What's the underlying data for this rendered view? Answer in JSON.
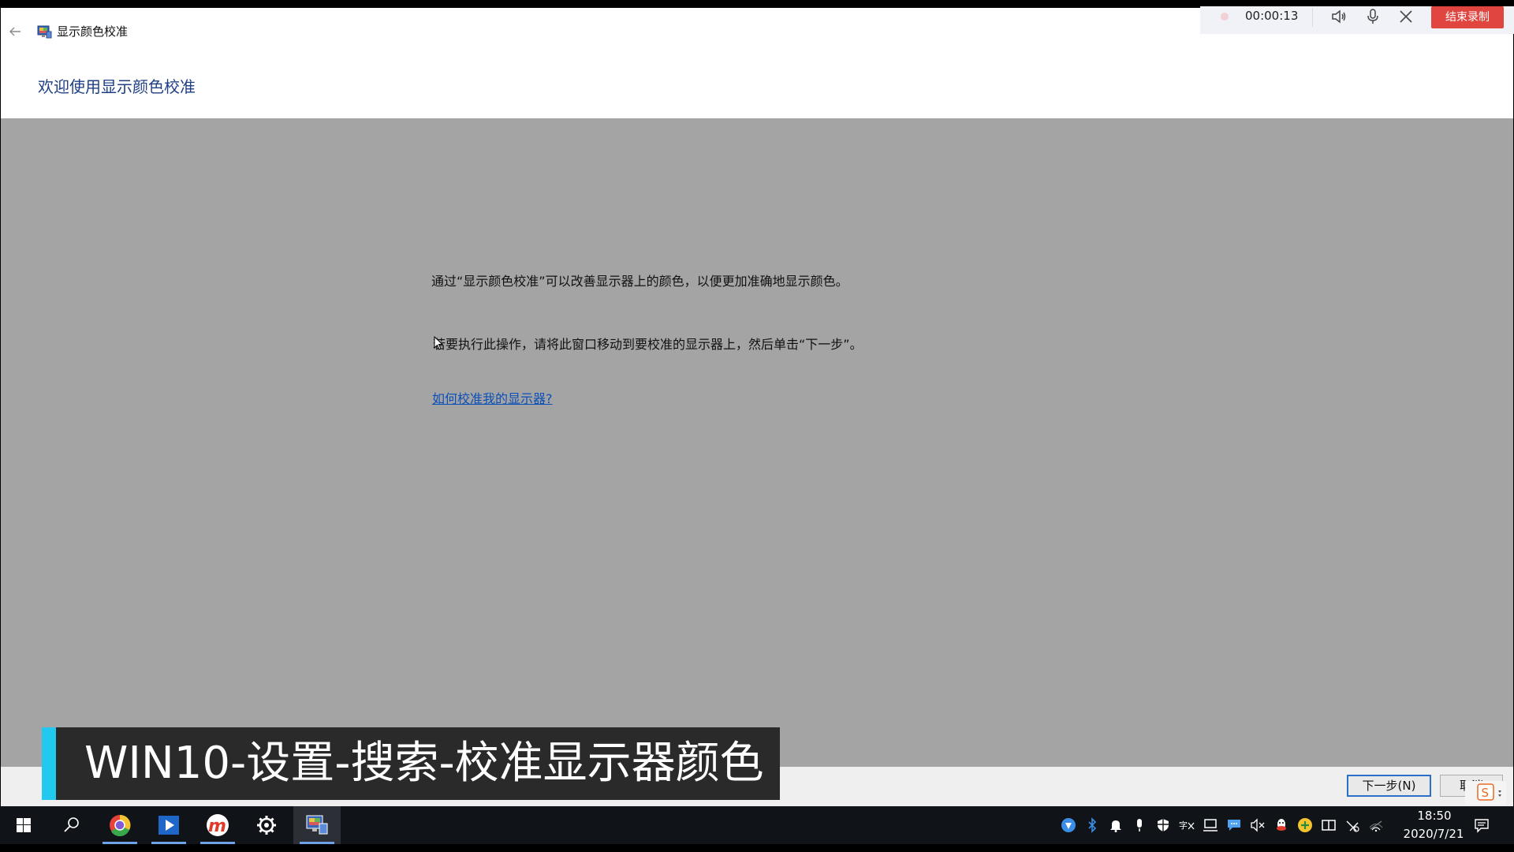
{
  "window": {
    "title": "显示颜色校准",
    "heading": "欢迎使用显示颜色校准"
  },
  "content": {
    "paragraph1": "通过“显示颜色校准”可以改善显示器上的颜色，以便更加准确地显示颜色。",
    "paragraph2": "若要执行此操作，请将此窗口移动到要校准的显示器上，然后单击“下一步”。",
    "help_link": "如何校准我的显示器?"
  },
  "buttons": {
    "next": "下一步(N)",
    "cancel": "取消"
  },
  "recorder": {
    "time": "00:00:13",
    "stop_label": "结束录制"
  },
  "caption": {
    "text": "WIN10-设置-搜索-校准显示器颜色"
  },
  "taskbar": {
    "apps": [
      "start-icon",
      "search-icon",
      "browser-icon",
      "video-player-icon",
      "m-app-icon",
      "settings-icon",
      "color-calibration-icon"
    ],
    "tray_icons": [
      "shield-app-icon",
      "bluetooth-icon",
      "notification-bell-icon",
      "microphone-icon",
      "security-icon",
      "language-icon",
      "display-icon",
      "chat-icon",
      "volume-muted-icon",
      "qq-icon",
      "wechat-icon",
      "ime-icon",
      "network-icon",
      "wifi-icon"
    ],
    "time": "18:50",
    "date": "2020/7/21"
  },
  "colors": {
    "window_body": "#a4a4a4",
    "heading": "#1e3f86",
    "link": "#0b4fb8",
    "caption_accent": "#22c9ee",
    "record_button": "#e0463f",
    "taskbar": "#101418"
  }
}
